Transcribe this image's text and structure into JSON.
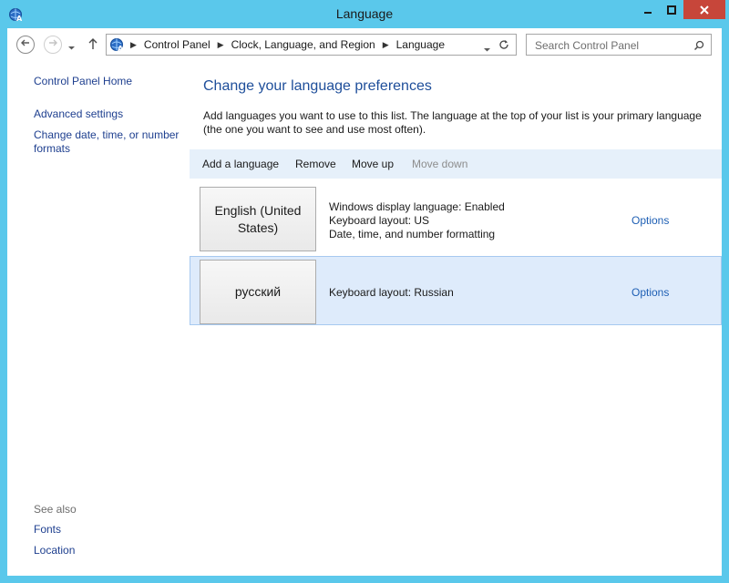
{
  "window": {
    "title": "Language"
  },
  "address": {
    "crumbs": [
      "Control Panel",
      "Clock, Language, and Region",
      "Language"
    ]
  },
  "search": {
    "placeholder": "Search Control Panel"
  },
  "left_pane": {
    "home": "Control Panel Home",
    "advanced": "Advanced settings",
    "change_date": "Change date, time, or number formats",
    "see_also": "See also",
    "fonts": "Fonts",
    "location": "Location"
  },
  "main": {
    "heading": "Change your language preferences",
    "description": "Add languages you want to use to this list. The language at the top of your list is your primary language (the one you want to see and use most often).",
    "toolbar": {
      "add": "Add a language",
      "remove": "Remove",
      "move_up": "Move up",
      "move_down": "Move down"
    },
    "languages": [
      {
        "name": "English (United States)",
        "info": [
          "Windows display language: Enabled",
          "Keyboard layout: US",
          "Date, time, and number formatting"
        ],
        "options": "Options"
      },
      {
        "name": "русский",
        "info": [
          "Keyboard layout: Russian"
        ],
        "options": "Options"
      }
    ]
  },
  "icons": {
    "title": "language-globe-icon",
    "back": "back-arrow-icon",
    "forward": "forward-arrow-icon",
    "recent": "chevron-down-icon",
    "up": "up-arrow-icon",
    "refresh": "refresh-icon",
    "search": "search-icon"
  },
  "colors": {
    "frame": "#5ac8eb",
    "close": "#c7463a",
    "heading": "#1e4e9a",
    "link": "#1e3f8f",
    "toolbar_bg": "#e6f0fa",
    "selected_bg": "#deebfb"
  }
}
